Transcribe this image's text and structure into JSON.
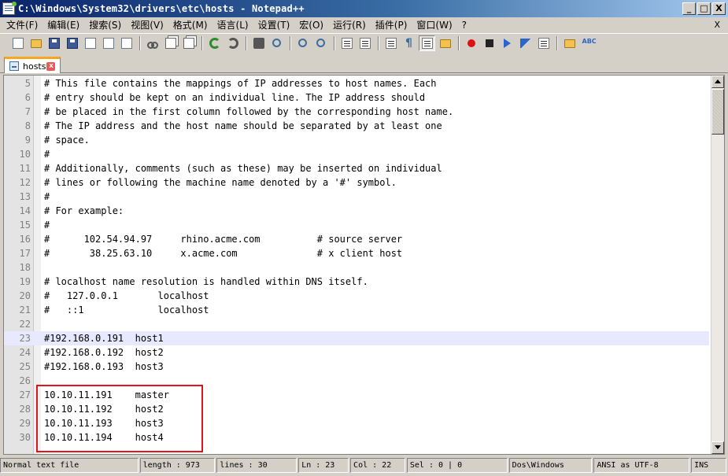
{
  "window": {
    "title": "C:\\Windows\\System32\\drivers\\etc\\hosts - Notepad++",
    "minimize": "_",
    "maximize": "□",
    "close": "X"
  },
  "menu": {
    "items": [
      "文件(F)",
      "编辑(E)",
      "搜索(S)",
      "视图(V)",
      "格式(M)",
      "语言(L)",
      "设置(T)",
      "宏(O)",
      "运行(R)",
      "插件(P)",
      "窗口(W)",
      "?"
    ],
    "close_doc": "X"
  },
  "toolbar": {
    "icons": [
      "new-file-icon",
      "open-file-icon",
      "save-icon",
      "save-all-icon",
      "close-icon",
      "close-all-icon",
      "print-icon",
      "cut-icon",
      "copy-icon",
      "paste-icon",
      "undo-icon",
      "redo-icon",
      "find-icon",
      "replace-icon",
      "zoom-in-icon",
      "zoom-out-icon",
      "sync-vertical-icon",
      "sync-horizontal-icon",
      "word-wrap-icon",
      "show-all-chars-icon",
      "indent-guide-icon",
      "doc-map-icon",
      "record-macro-icon",
      "stop-macro-icon",
      "play-macro-icon",
      "run-macro-multiple-icon",
      "save-macro-icon",
      "folder-icon",
      "spell-check-icon"
    ]
  },
  "tab": {
    "label": "hosts",
    "close": "x"
  },
  "editor": {
    "current_line": 23,
    "lines": [
      {
        "n": "5",
        "text": "# This file contains the mappings of IP addresses to host names. Each"
      },
      {
        "n": "6",
        "text": "# entry should be kept on an individual line. The IP address should"
      },
      {
        "n": "7",
        "text": "# be placed in the first column followed by the corresponding host name."
      },
      {
        "n": "8",
        "text": "# The IP address and the host name should be separated by at least one"
      },
      {
        "n": "9",
        "text": "# space."
      },
      {
        "n": "10",
        "text": "#"
      },
      {
        "n": "11",
        "text": "# Additionally, comments (such as these) may be inserted on individual"
      },
      {
        "n": "12",
        "text": "# lines or following the machine name denoted by a '#' symbol."
      },
      {
        "n": "13",
        "text": "#"
      },
      {
        "n": "14",
        "text": "# For example:"
      },
      {
        "n": "15",
        "text": "#"
      },
      {
        "n": "16",
        "text": "#      102.54.94.97     rhino.acme.com          # source server"
      },
      {
        "n": "17",
        "text": "#       38.25.63.10     x.acme.com              # x client host"
      },
      {
        "n": "18",
        "text": ""
      },
      {
        "n": "19",
        "text": "# localhost name resolution is handled within DNS itself."
      },
      {
        "n": "20",
        "text": "#   127.0.0.1       localhost"
      },
      {
        "n": "21",
        "text": "#   ::1             localhost"
      },
      {
        "n": "22",
        "text": ""
      },
      {
        "n": "23",
        "text": "#192.168.0.191  host1"
      },
      {
        "n": "24",
        "text": "#192.168.0.192  host2"
      },
      {
        "n": "25",
        "text": "#192.168.0.193  host3"
      },
      {
        "n": "26",
        "text": ""
      },
      {
        "n": "27",
        "text": "10.10.11.191    master"
      },
      {
        "n": "28",
        "text": "10.10.11.192    host2"
      },
      {
        "n": "29",
        "text": "10.10.11.193    host3"
      },
      {
        "n": "30",
        "text": "10.10.11.194    host4"
      }
    ]
  },
  "status": {
    "file_type": "Normal text file",
    "length": "length : 973",
    "lines": "lines : 30",
    "ln": "Ln : 23",
    "col": "Col : 22",
    "sel": "Sel : 0 | 0",
    "eol": "Dos\\Windows",
    "encoding": "ANSI as UTF-8",
    "mode": "INS"
  },
  "colors": {
    "highlight_box": "#e0151c",
    "current_line_bg": "#e8e8ff",
    "tab_accent": "#f7a61d"
  }
}
